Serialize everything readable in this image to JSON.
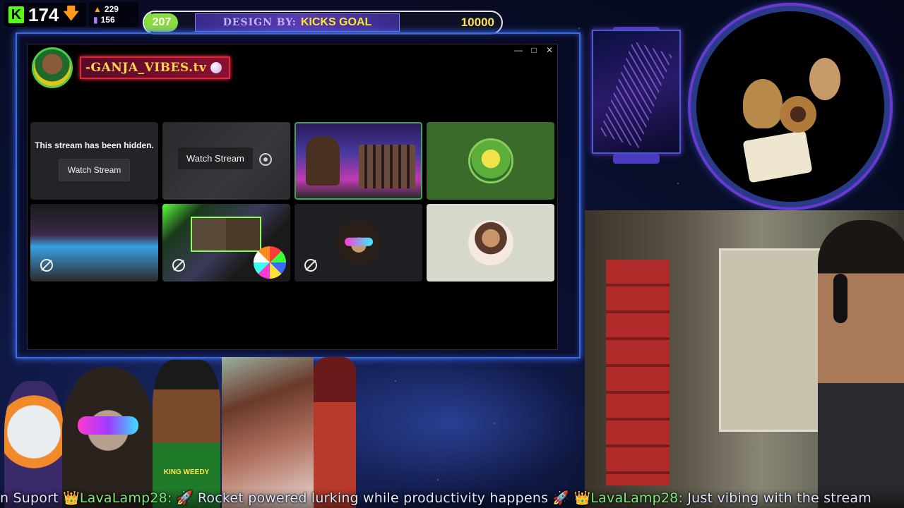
{
  "hud": {
    "kick_logo": "K",
    "kick_followers": "174",
    "kick_arrow": "🡇",
    "stat_1": "229",
    "stat_2": "156"
  },
  "goal": {
    "current": "207",
    "design_text": "DESIGN BY:",
    "label": "KICKS GOAL",
    "target": "10000",
    "progress_fraction": 0.0207
  },
  "window": {
    "minimize_icon": "—",
    "maximize_icon": "□",
    "close_icon": "✕"
  },
  "server": {
    "name": "-GANJA_VIBES.tv"
  },
  "streams": {
    "hidden_text": "This stream has been hidden.",
    "watch_label": "Watch Stream",
    "watch_label_2": "Watch Stream"
  },
  "emotes": {
    "weedy_label": "KING WEEDY"
  },
  "ticker": {
    "part1": "n Suport ",
    "crown1": "👑",
    "user1": "LavaLamp28:",
    "msg1": " 🚀 Rocket powered lurking while productivity happens 🚀 ",
    "crown2": "👑",
    "user2": "LavaLamp28:",
    "msg2": " Just vibing with the stream"
  },
  "colors": {
    "kick_green": "#53fc18",
    "goal_green": "#8bdc3f",
    "goal_yellow": "#f4ea2a",
    "frame_blue": "#3a6bd9",
    "discord_panel": "#232428"
  }
}
